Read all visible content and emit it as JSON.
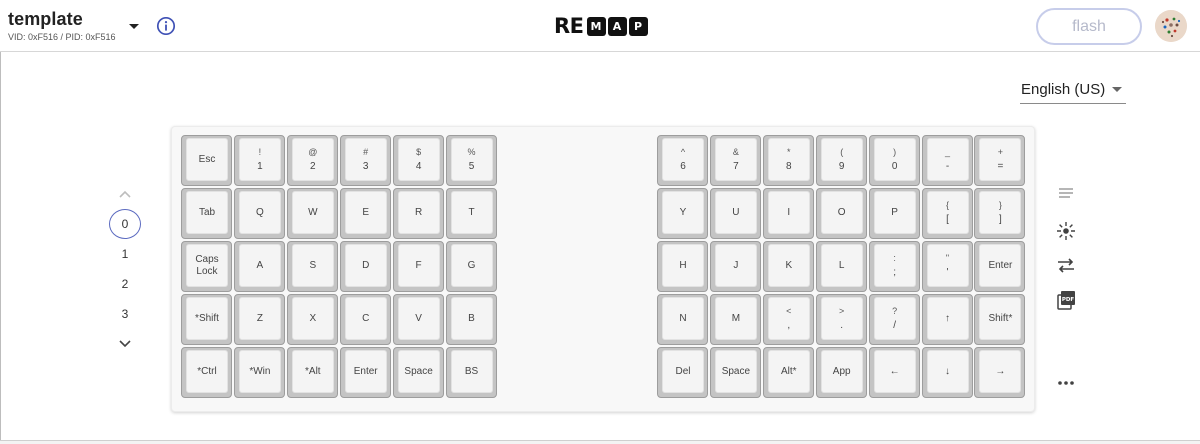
{
  "header": {
    "keyboard_name": "template",
    "vid_pid": "VID: 0xF516 / PID: 0xF516",
    "logo": {
      "re": "RE",
      "letters": [
        "M",
        "A",
        "P"
      ]
    },
    "flash_label": "flash"
  },
  "language": {
    "selected": "English (US)"
  },
  "layers": {
    "items": [
      "0",
      "1",
      "2",
      "3"
    ],
    "active": "0"
  },
  "keyboard": {
    "left": [
      [
        [
          "",
          "Esc"
        ],
        [
          "!",
          "1"
        ],
        [
          "@",
          "2"
        ],
        [
          "#",
          "3"
        ],
        [
          "$",
          "4"
        ],
        [
          "%",
          "5"
        ]
      ],
      [
        [
          "",
          "Tab"
        ],
        [
          "",
          "Q"
        ],
        [
          "",
          "W"
        ],
        [
          "",
          "E"
        ],
        [
          "",
          "R"
        ],
        [
          "",
          "T"
        ]
      ],
      [
        [
          "",
          "Caps\nLock"
        ],
        [
          "",
          "A"
        ],
        [
          "",
          "S"
        ],
        [
          "",
          "D"
        ],
        [
          "",
          "F"
        ],
        [
          "",
          "G"
        ]
      ],
      [
        [
          "",
          "*Shift"
        ],
        [
          "",
          "Z"
        ],
        [
          "",
          "X"
        ],
        [
          "",
          "C"
        ],
        [
          "",
          "V"
        ],
        [
          "",
          "B"
        ]
      ],
      [
        [
          "",
          "*Ctrl"
        ],
        [
          "",
          "*Win"
        ],
        [
          "",
          "*Alt"
        ],
        [
          "",
          "Enter"
        ],
        [
          "",
          "Space"
        ],
        [
          "",
          "BS"
        ]
      ]
    ],
    "right": [
      [
        [
          "^",
          "6"
        ],
        [
          "&",
          "7"
        ],
        [
          "*",
          "8"
        ],
        [
          "(",
          "9"
        ],
        [
          ")",
          "0"
        ],
        [
          "_",
          "-"
        ],
        [
          "+",
          "="
        ]
      ],
      [
        [
          "",
          "Y"
        ],
        [
          "",
          "U"
        ],
        [
          "",
          "I"
        ],
        [
          "",
          "O"
        ],
        [
          "",
          "P"
        ],
        [
          "{",
          "["
        ],
        [
          "}",
          "]"
        ]
      ],
      [
        [
          "",
          "H"
        ],
        [
          "",
          "J"
        ],
        [
          "",
          "K"
        ],
        [
          "",
          "L"
        ],
        [
          ":",
          ";"
        ],
        [
          "\"",
          "'"
        ],
        [
          "",
          "Enter"
        ]
      ],
      [
        [
          "",
          "N"
        ],
        [
          "",
          "M"
        ],
        [
          "<",
          ","
        ],
        [
          ">",
          "."
        ],
        [
          "?",
          "/"
        ],
        [
          "",
          "↑"
        ],
        [
          "",
          "Shift*"
        ]
      ],
      [
        [
          "",
          "Del"
        ],
        [
          "",
          "Space"
        ],
        [
          "",
          "Alt*"
        ],
        [
          "",
          "App"
        ],
        [
          "",
          "←"
        ],
        [
          "",
          "↓"
        ],
        [
          "",
          "→"
        ]
      ]
    ]
  },
  "tools": [
    "menu-lines-icon",
    "lighting-icon",
    "swap-icon",
    "pdf-icon",
    "more-icon"
  ],
  "colors": {
    "accent": "#5c6bc0",
    "flash_border": "#c7cdea",
    "key_frame": "#c4c4c4",
    "key_cap": "#f4f4f4"
  }
}
